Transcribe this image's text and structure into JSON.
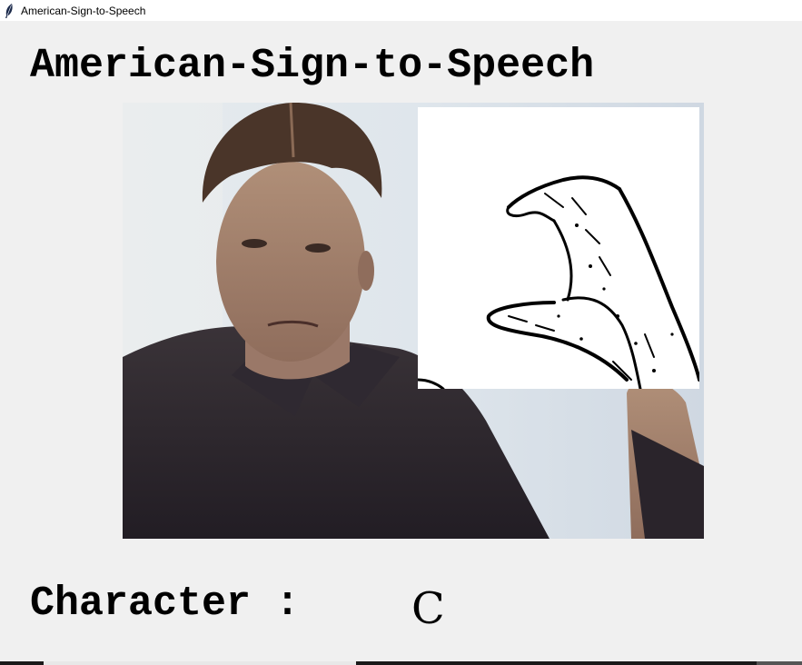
{
  "window": {
    "title": "American-Sign-to-Speech"
  },
  "main": {
    "heading": "American-Sign-to-Speech",
    "character_label": "Character :",
    "character_value": "C"
  },
  "icons": {
    "app_icon": "feather-icon"
  }
}
